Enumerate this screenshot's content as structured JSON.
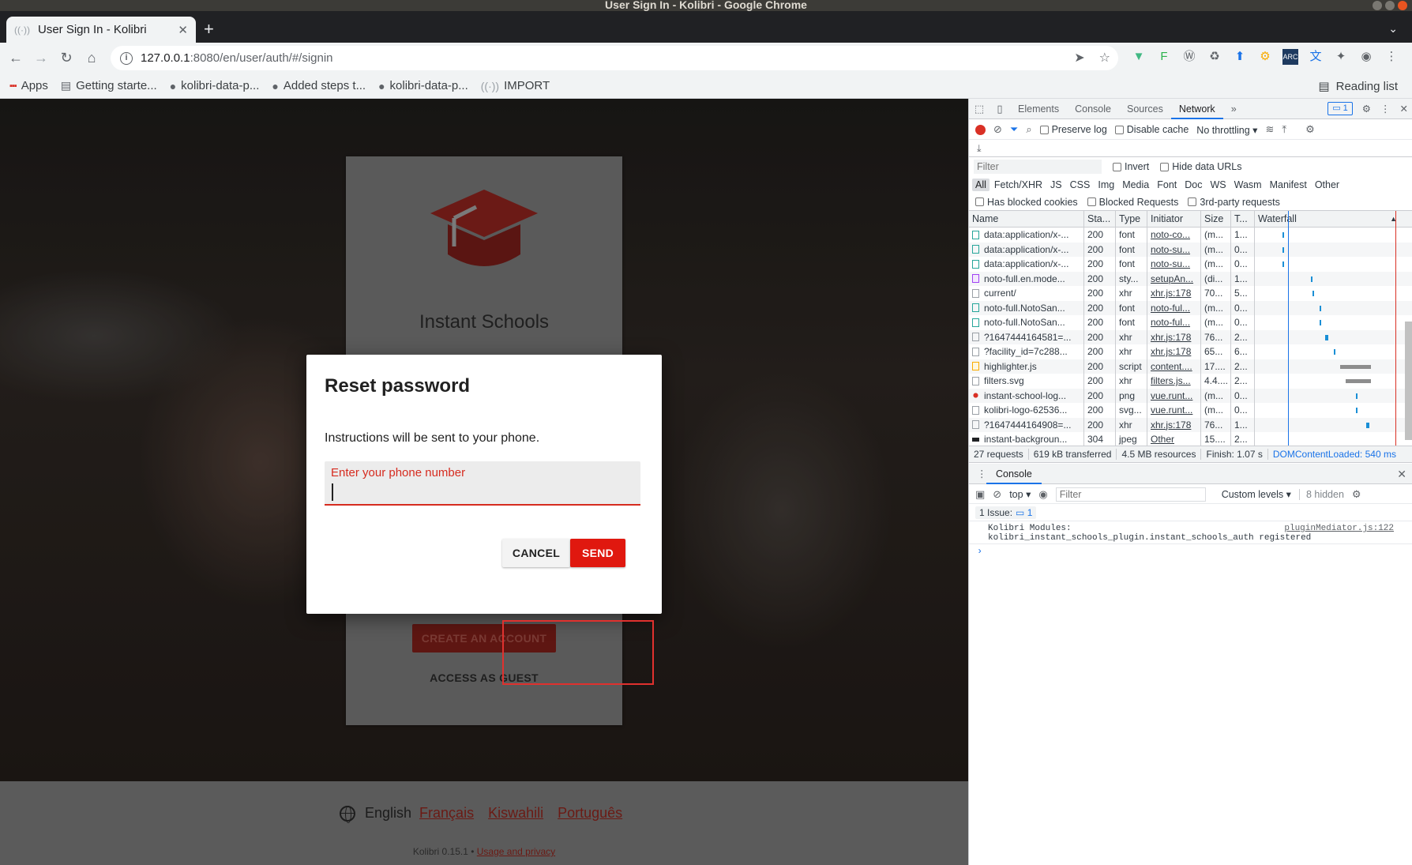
{
  "os_window": {
    "title": "User Sign In - Kolibri - Google Chrome"
  },
  "browser": {
    "tab_title": "User Sign In - Kolibri",
    "new_tab_label": "+",
    "url_host": "127.0.0.1",
    "url_rest": ":8080/en/user/auth/#/signin",
    "bookmarks": [
      {
        "label": "Apps",
        "icon": "apps-grid-icon"
      },
      {
        "label": "Getting starte...",
        "icon": "doc-icon"
      },
      {
        "label": "kolibri-data-p...",
        "icon": "github-icon"
      },
      {
        "label": "Added steps t...",
        "icon": "github-icon"
      },
      {
        "label": "kolibri-data-p...",
        "icon": "github-icon"
      },
      {
        "label": "IMPORT",
        "icon": "radio-icon"
      }
    ],
    "reading_list_label": "Reading list"
  },
  "page": {
    "school_name": "Instant Schools",
    "create_account_label": "CREATE AN ACCOUNT",
    "access_guest_label": "ACCESS AS GUEST",
    "footer": {
      "current_language": "English",
      "languages": [
        "Français",
        "Kiswahili",
        "Português"
      ],
      "version_text": "Kolibri 0.15.1 •",
      "usage_link": "Usage and privacy"
    },
    "colors": {
      "brand_red": "#e0180f",
      "error_red": "#d62b1f"
    }
  },
  "modal": {
    "title": "Reset password",
    "description": "Instructions will be sent to your phone.",
    "phone_label": "Enter your phone number",
    "phone_value": "",
    "cancel_label": "CANCEL",
    "send_label": "SEND"
  },
  "devtools": {
    "tabs": [
      "Elements",
      "Console",
      "Sources",
      "Network"
    ],
    "active_tab": "Network",
    "more_tabs": "»",
    "issues_badge": "1",
    "toolbar": {
      "preserve_log": "Preserve log",
      "disable_cache": "Disable cache",
      "throttling": "No throttling"
    },
    "filter_placeholder": "Filter",
    "invert_label": "Invert",
    "hide_data_urls_label": "Hide data URLs",
    "types": [
      "All",
      "Fetch/XHR",
      "JS",
      "CSS",
      "Img",
      "Media",
      "Font",
      "Doc",
      "WS",
      "Wasm",
      "Manifest",
      "Other"
    ],
    "active_type": "All",
    "cookie_filters": [
      "Has blocked cookies",
      "Blocked Requests",
      "3rd-party requests"
    ],
    "columns": [
      "Name",
      "Sta...",
      "Type",
      "Initiator",
      "Size",
      "T...",
      "Waterfall"
    ],
    "rows": [
      {
        "name": "data:application/x-...",
        "status": "200",
        "type": "font",
        "initiator": "noto-co...",
        "size": "(m...",
        "time": "1...",
        "icon": "font",
        "wf": [
          0.19,
          0.01,
          "blue"
        ]
      },
      {
        "name": "data:application/x-...",
        "status": "200",
        "type": "font",
        "initiator": "noto-su...",
        "size": "(m...",
        "time": "0...",
        "icon": "font",
        "wf": [
          0.19,
          0.01,
          "blue"
        ]
      },
      {
        "name": "data:application/x-...",
        "status": "200",
        "type": "font",
        "initiator": "noto-su...",
        "size": "(m...",
        "time": "0...",
        "icon": "font",
        "wf": [
          0.19,
          0.01,
          "blue"
        ]
      },
      {
        "name": "noto-full.en.mode...",
        "status": "200",
        "type": "sty...",
        "initiator": "setupAn...",
        "size": "(di...",
        "time": "1...",
        "icon": "style",
        "wf": [
          0.38,
          0.01,
          "blue"
        ]
      },
      {
        "name": "current/",
        "status": "200",
        "type": "xhr",
        "initiator": "xhr.js:178",
        "size": "70...",
        "time": "5...",
        "icon": "doc",
        "wf": [
          0.39,
          0.01,
          "blue"
        ]
      },
      {
        "name": "noto-full.NotoSan...",
        "status": "200",
        "type": "font",
        "initiator": "noto-ful...",
        "size": "(m...",
        "time": "0...",
        "icon": "font",
        "wf": [
          0.44,
          0.01,
          "blue"
        ]
      },
      {
        "name": "noto-full.NotoSan...",
        "status": "200",
        "type": "font",
        "initiator": "noto-ful...",
        "size": "(m...",
        "time": "0...",
        "icon": "font",
        "wf": [
          0.44,
          0.01,
          "blue"
        ]
      },
      {
        "name": "?1647444164581=...",
        "status": "200",
        "type": "xhr",
        "initiator": "xhr.js:178",
        "size": "76...",
        "time": "2...",
        "icon": "doc",
        "wf": [
          0.48,
          0.02,
          "blue"
        ]
      },
      {
        "name": "?facility_id=7c288...",
        "status": "200",
        "type": "xhr",
        "initiator": "xhr.js:178",
        "size": "65...",
        "time": "6...",
        "icon": "doc",
        "wf": [
          0.54,
          0.01,
          "blue"
        ]
      },
      {
        "name": "highlighter.js",
        "status": "200",
        "type": "script",
        "initiator": "content....",
        "size": "17....",
        "time": "2...",
        "icon": "script",
        "wf": [
          0.58,
          0.21,
          "gray"
        ]
      },
      {
        "name": "filters.svg",
        "status": "200",
        "type": "xhr",
        "initiator": "filters.js...",
        "size": "4.4....",
        "time": "2...",
        "icon": "doc",
        "wf": [
          0.62,
          0.17,
          "gray"
        ]
      },
      {
        "name": "instant-school-log...",
        "status": "200",
        "type": "png",
        "initiator": "vue.runt...",
        "size": "(m...",
        "time": "0...",
        "icon": "png",
        "wf": [
          0.69,
          0.01,
          "blue"
        ]
      },
      {
        "name": "kolibri-logo-62536...",
        "status": "200",
        "type": "svg...",
        "initiator": "vue.runt...",
        "size": "(m...",
        "time": "0...",
        "icon": "doc",
        "wf": [
          0.69,
          0.01,
          "blue"
        ]
      },
      {
        "name": "?1647444164908=...",
        "status": "200",
        "type": "xhr",
        "initiator": "xhr.js:178",
        "size": "76...",
        "time": "1...",
        "icon": "doc",
        "wf": [
          0.76,
          0.02,
          "blue"
        ]
      },
      {
        "name": "instant-backgroun...",
        "status": "304",
        "type": "jpeg",
        "initiator": "Other",
        "size": "15....",
        "time": "2...",
        "icon": "jpeg",
        "wf": [
          0.0,
          0.0,
          "blue"
        ]
      }
    ],
    "status_bar": {
      "requests": "27 requests",
      "transferred": "619 kB transferred",
      "resources": "4.5 MB resources",
      "finish": "Finish: 1.07 s",
      "dom_content_loaded": "DOMContentLoaded: 540 ms"
    },
    "console": {
      "tab_label": "Console",
      "context": "top",
      "filter_placeholder": "Filter",
      "levels": "Custom levels",
      "hidden": "8 hidden",
      "issues_label": "1 Issue:",
      "issues_count": "1",
      "message_line1": "Kolibri Modules:",
      "message_line2": "kolibri_instant_schools_plugin.instant_schools_auth registered",
      "message_source": "pluginMediator.js:122",
      "prompt": "›"
    }
  }
}
